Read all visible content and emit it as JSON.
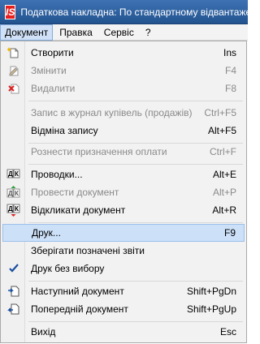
{
  "window": {
    "logo": "IS",
    "title": "Податкова накладна: По стандартному відвантаженню"
  },
  "menubar": {
    "items": [
      "Документ",
      "Правка",
      "Сервіс",
      "?"
    ]
  },
  "menu": {
    "create": {
      "label": "Створити",
      "shortcut": "Ins"
    },
    "edit": {
      "label": "Змінити",
      "shortcut": "F4"
    },
    "delete": {
      "label": "Видалити",
      "shortcut": "F8"
    },
    "register": {
      "label": "Запис в журнал купівель (продажів)",
      "shortcut": "Ctrl+F5"
    },
    "cancel_record": {
      "label": "Відміна запису",
      "shortcut": "Alt+F5"
    },
    "distribute": {
      "label": "Рознести призначення оплати",
      "shortcut": "Ctrl+F"
    },
    "postings": {
      "label": "Проводки...",
      "shortcut": "Alt+E"
    },
    "post_doc": {
      "label": "Провести документ",
      "shortcut": "Alt+P"
    },
    "unpost_doc": {
      "label": "Відкликати документ",
      "shortcut": "Alt+R"
    },
    "print": {
      "label": "Друк...",
      "shortcut": "F9"
    },
    "save_reports": {
      "label": "Зберігати позначені звіти",
      "shortcut": ""
    },
    "print_no_choice": {
      "label": "Друк без вибору",
      "shortcut": ""
    },
    "next_doc": {
      "label": "Наступний документ",
      "shortcut": "Shift+PgDn"
    },
    "prev_doc": {
      "label": "Попередній документ",
      "shortcut": "Shift+PgUp"
    },
    "exit": {
      "label": "Вихід",
      "shortcut": "Esc"
    }
  },
  "icons": {
    "dk_text": "ДК"
  }
}
